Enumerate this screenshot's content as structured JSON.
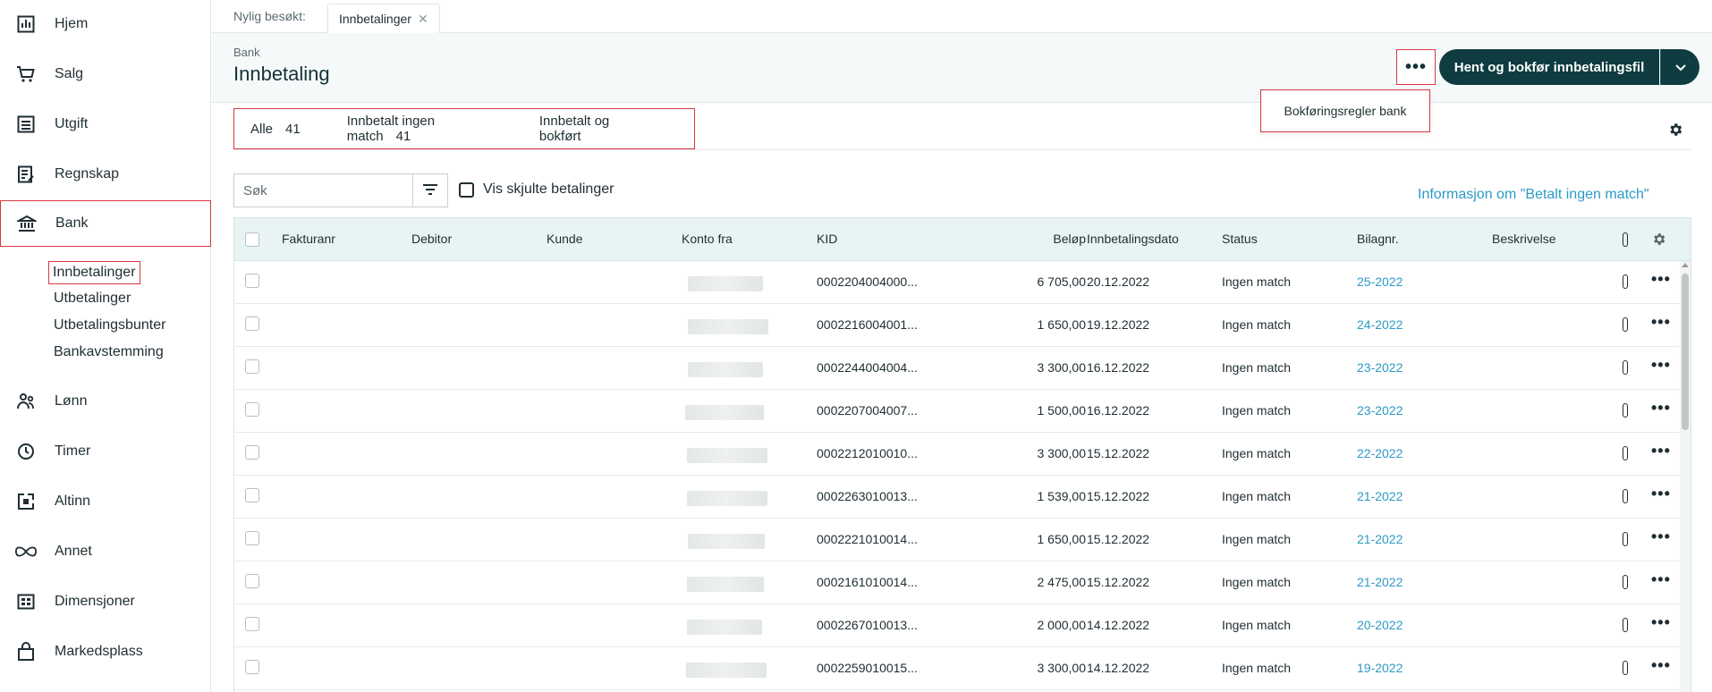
{
  "sidebar": {
    "items": [
      {
        "label": "Hjem",
        "icon": "chart-icon"
      },
      {
        "label": "Salg",
        "icon": "cart-icon"
      },
      {
        "label": "Utgift",
        "icon": "list-icon"
      },
      {
        "label": "Regnskap",
        "icon": "ledger-icon"
      },
      {
        "label": "Bank",
        "icon": "bank-icon"
      },
      {
        "label": "Lønn",
        "icon": "people-icon"
      },
      {
        "label": "Timer",
        "icon": "clock-icon"
      },
      {
        "label": "Altinn",
        "icon": "altinn-icon"
      },
      {
        "label": "Annet",
        "icon": "infinity-icon"
      },
      {
        "label": "Dimensjoner",
        "icon": "dimensions-icon"
      },
      {
        "label": "Markedsplass",
        "icon": "bag-icon"
      }
    ],
    "bank_sub": [
      "Innbetalinger",
      "Utbetalinger",
      "Utbetalingsbunter",
      "Bankavstemming"
    ]
  },
  "tabbar": {
    "recent_label": "Nylig besøkt:",
    "recent_tab": "Innbetalinger"
  },
  "header": {
    "breadcrumb": "Bank",
    "title": "Innbetaling",
    "more_label": "•••",
    "primary_button": "Hent og bokfør innbetalingsfil",
    "dropdown_item": "Bokføringsregler bank"
  },
  "filters": [
    {
      "label": "Alle",
      "count": "41"
    },
    {
      "label": "Innbetalt ingen match",
      "count": "41"
    },
    {
      "label": "Innbetalt og bokført",
      "count": ""
    }
  ],
  "search": {
    "placeholder": "Søk",
    "hidden_toggle": "Vis skjulte betalinger",
    "info_link": "Informasjon om \"Betalt ingen match\""
  },
  "table": {
    "columns": [
      "Fakturanr",
      "Debitor",
      "Kunde",
      "Konto fra",
      "KID",
      "Beløp",
      "Innbetalingsdato",
      "Status",
      "Bilagnr.",
      "Beskrivelse"
    ],
    "rows": [
      {
        "kid": "0002204004000...",
        "amount": "6 705,00",
        "date": "20.12.2022",
        "status": "Ingen match",
        "bilag": "25-2022"
      },
      {
        "kid": "0002216004001...",
        "amount": "1 650,00",
        "date": "19.12.2022",
        "status": "Ingen match",
        "bilag": "24-2022"
      },
      {
        "kid": "0002244004004...",
        "amount": "3 300,00",
        "date": "16.12.2022",
        "status": "Ingen match",
        "bilag": "23-2022"
      },
      {
        "kid": "0002207004007...",
        "amount": "1 500,00",
        "date": "16.12.2022",
        "status": "Ingen match",
        "bilag": "23-2022"
      },
      {
        "kid": "0002212010010...",
        "amount": "3 300,00",
        "date": "15.12.2022",
        "status": "Ingen match",
        "bilag": "22-2022"
      },
      {
        "kid": "0002263010013...",
        "amount": "1 539,00",
        "date": "15.12.2022",
        "status": "Ingen match",
        "bilag": "21-2022"
      },
      {
        "kid": "0002221010014...",
        "amount": "1 650,00",
        "date": "15.12.2022",
        "status": "Ingen match",
        "bilag": "21-2022"
      },
      {
        "kid": "0002161010014...",
        "amount": "2 475,00",
        "date": "15.12.2022",
        "status": "Ingen match",
        "bilag": "21-2022"
      },
      {
        "kid": "0002267010013...",
        "amount": "2 000,00",
        "date": "14.12.2022",
        "status": "Ingen match",
        "bilag": "20-2022"
      },
      {
        "kid": "0002259010015...",
        "amount": "3 300,00",
        "date": "14.12.2022",
        "status": "Ingen match",
        "bilag": "19-2022"
      }
    ]
  },
  "colors": {
    "primary": "#0f3c40",
    "link": "#2d9ac5",
    "highlight": "#d9393e",
    "table_header_bg": "#e8f3f4"
  }
}
